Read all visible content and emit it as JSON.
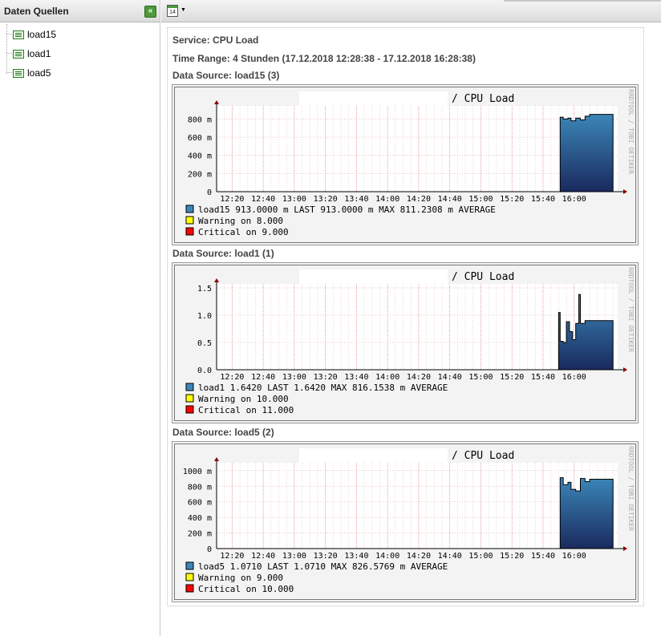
{
  "sidebar": {
    "title": "Daten Quellen",
    "collapse_icon": "double-chevron-left-icon",
    "items": [
      {
        "label": "load15"
      },
      {
        "label": "load1"
      },
      {
        "label": "load5"
      }
    ]
  },
  "toolbar": {
    "calendar_icon": "calendar-icon",
    "calendar_day": "14"
  },
  "report": {
    "service": "Service: CPU Load",
    "time_range": "Time Range: 4 Stunden (17.12.2018 12:28:38 - 17.12.2018 16:28:38)",
    "sections": [
      {
        "header": "Data Source: load15 (3)"
      },
      {
        "header": "Data Source: load1 (1)"
      },
      {
        "header": "Data Source: load5 (2)"
      }
    ]
  },
  "colors": {
    "area_top": "#3b86b8",
    "area_bottom": "#1a2a5e",
    "warning": "#ffff00",
    "critical": "#ff0000",
    "grid_minor": "#e5b8b8",
    "axis_arrow": "#8b0000"
  },
  "chart_data": [
    {
      "type": "area",
      "title": "/ CPU Load",
      "watermark": "RRDTOOL / TOBI OETIKER",
      "x_ticks": [
        "12:20",
        "12:40",
        "13:00",
        "13:20",
        "13:40",
        "14:00",
        "14:20",
        "14:40",
        "15:00",
        "15:20",
        "15:40",
        "16:00"
      ],
      "y_ticks": [
        "0",
        "200 m",
        "400 m",
        "600 m",
        "800 m"
      ],
      "ylim": [
        0,
        900
      ],
      "series": [
        {
          "name": "load15",
          "x": [
            "15:51",
            "15:53",
            "15:56",
            "15:58",
            "16:01",
            "16:04",
            "16:07",
            "16:10"
          ],
          "values": [
            820,
            800,
            810,
            780,
            810,
            790,
            830,
            850
          ]
        }
      ],
      "legend": [
        {
          "label": "load15",
          "text": "load15    913.0000 m LAST    913.0000 m MAX   811.2308 m AVERAGE"
        },
        {
          "label": "Warning on",
          "text": "Warning on  8.000"
        },
        {
          "label": "Critical on",
          "text": "Critical on 9.000"
        }
      ]
    },
    {
      "type": "area",
      "title": "/ CPU Load",
      "watermark": "RRDTOOL / TOBI OETIKER",
      "x_ticks": [
        "12:20",
        "12:40",
        "13:00",
        "13:20",
        "13:40",
        "14:00",
        "14:20",
        "14:40",
        "15:00",
        "15:20",
        "15:40",
        "16:00"
      ],
      "y_ticks": [
        "0.0",
        "0.5",
        "1.0",
        "1.5"
      ],
      "ylim": [
        0,
        1.5
      ],
      "series": [
        {
          "name": "load1",
          "x": [
            "15:50",
            "15:51",
            "15:53",
            "15:55",
            "15:57",
            "15:59",
            "16:01",
            "16:03",
            "16:04",
            "16:07"
          ],
          "values": [
            1.05,
            0.52,
            0.5,
            0.88,
            0.7,
            0.55,
            0.85,
            1.38,
            0.85,
            0.9
          ]
        }
      ],
      "legend": [
        {
          "label": "load1",
          "text": "load1   1.6420   LAST    1.6420   MAX   816.1538 m AVERAGE"
        },
        {
          "label": "Warning on",
          "text": "Warning on  10.000"
        },
        {
          "label": "Critical on",
          "text": "Critical on 11.000"
        }
      ]
    },
    {
      "type": "area",
      "title": "/ CPU Load",
      "watermark": "RRDTOOL / TOBI OETIKER",
      "x_ticks": [
        "12:20",
        "12:40",
        "13:00",
        "13:20",
        "13:40",
        "14:00",
        "14:20",
        "14:40",
        "15:00",
        "15:20",
        "15:40",
        "16:00"
      ],
      "y_ticks": [
        "0",
        "200 m",
        "400 m",
        "600 m",
        "800 m",
        "1000 m"
      ],
      "ylim": [
        0,
        1050
      ],
      "series": [
        {
          "name": "load5",
          "x": [
            "15:51",
            "15:53",
            "15:56",
            "15:58",
            "16:01",
            "16:04",
            "16:07",
            "16:10"
          ],
          "values": [
            910,
            820,
            850,
            760,
            740,
            900,
            860,
            890
          ]
        }
      ],
      "legend": [
        {
          "label": "load5",
          "text": "load5   1.0710   LAST    1.0710   MAX   826.5769 m AVERAGE"
        },
        {
          "label": "Warning on",
          "text": "Warning on  9.000"
        },
        {
          "label": "Critical on",
          "text": "Critical on 10.000"
        }
      ]
    }
  ]
}
